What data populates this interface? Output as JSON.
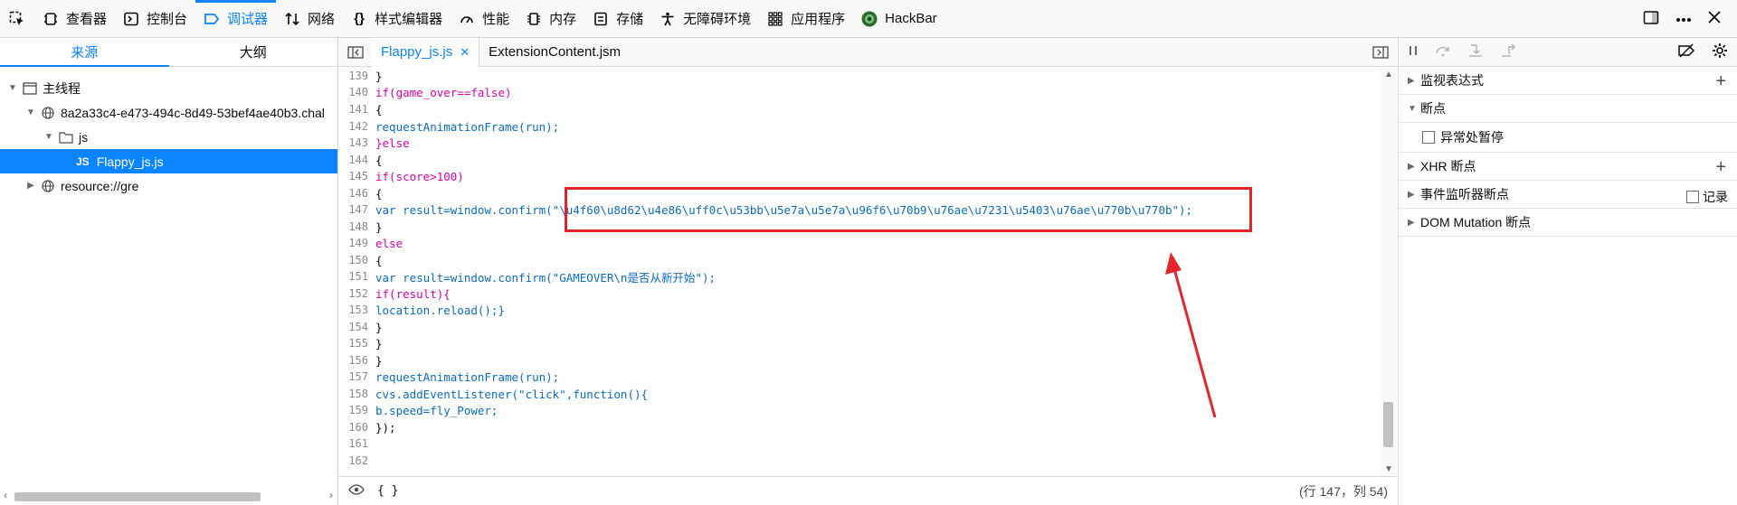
{
  "toolbar": {
    "tabs": [
      {
        "label": "查看器",
        "icon": "inspector-icon"
      },
      {
        "label": "控制台",
        "icon": "console-icon"
      },
      {
        "label": "调试器",
        "icon": "debugger-icon"
      },
      {
        "label": "网络",
        "icon": "network-icon"
      },
      {
        "label": "样式编辑器",
        "icon": "style-editor-icon"
      },
      {
        "label": "性能",
        "icon": "performance-icon"
      },
      {
        "label": "内存",
        "icon": "memory-icon"
      },
      {
        "label": "存储",
        "icon": "storage-icon"
      },
      {
        "label": "无障碍环境",
        "icon": "accessibility-icon"
      },
      {
        "label": "应用程序",
        "icon": "application-icon"
      },
      {
        "label": "HackBar",
        "icon": "hackbar-icon"
      }
    ],
    "active_tab": "调试器",
    "accent": "#0a84ff"
  },
  "sources": {
    "tabs": [
      "来源",
      "大纲"
    ],
    "active_tab": "来源",
    "tree": [
      {
        "label": "主线程",
        "icon": "window-icon",
        "twisty": "open"
      },
      {
        "label": "8a2a33c4-e473-494c-8d49-53bef4ae40b3.chal",
        "icon": "globe-icon",
        "twisty": "open"
      },
      {
        "label": "js",
        "icon": "folder-icon",
        "twisty": "open"
      },
      {
        "label": "Flappy_js.js",
        "icon": "js-file-icon",
        "badge": "JS",
        "selected": true
      },
      {
        "label": "resource://gre",
        "icon": "globe-icon",
        "twisty": "closed"
      }
    ]
  },
  "editor": {
    "tabs": [
      {
        "label": "Flappy_js.js",
        "active": true,
        "close": "✕"
      },
      {
        "label": "ExtensionContent.jsm",
        "active": false
      }
    ],
    "lines": [
      {
        "n": "139",
        "text": "}"
      },
      {
        "n": "140",
        "text": "if(game_over==false)"
      },
      {
        "n": "141",
        "text": "{"
      },
      {
        "n": "142",
        "text": "requestAnimationFrame(run);"
      },
      {
        "n": "143",
        "text": "}else"
      },
      {
        "n": "144",
        "text": "{"
      },
      {
        "n": "145",
        "text": "if(score>100)"
      },
      {
        "n": "146",
        "text": "{"
      },
      {
        "n": "147",
        "text": "var result=window.confirm(\"\\u4f60\\u8d62\\u4e86\\uff0c\\u53bb\\u5e7a\\u5e7a\\u96f6\\u70b9\\u76ae\\u7231\\u5403\\u76ae\\u770b\\u770b\");"
      },
      {
        "n": "148",
        "text": "}"
      },
      {
        "n": "149",
        "text": "else"
      },
      {
        "n": "150",
        "text": "{"
      },
      {
        "n": "151",
        "text": "var result=window.confirm(\"GAMEOVER\\n是否从新开始\");"
      },
      {
        "n": "152",
        "text": "if(result){"
      },
      {
        "n": "153",
        "text": "location.reload();}"
      },
      {
        "n": "154",
        "text": "}"
      },
      {
        "n": "155",
        "text": "}"
      },
      {
        "n": "156",
        "text": "}"
      },
      {
        "n": "157",
        "text": "requestAnimationFrame(run);"
      },
      {
        "n": "158",
        "text": "cvs.addEventListener(\"click\",function(){"
      },
      {
        "n": "159",
        "text": "b.speed=fly_Power;"
      },
      {
        "n": "160",
        "text": "});"
      },
      {
        "n": "161",
        "text": ""
      },
      {
        "n": "162",
        "text": ""
      }
    ],
    "footer_braces": "{ }",
    "cursor_position": "(行 147，列 54)",
    "annotation_color": "#e4262c"
  },
  "right_pane": {
    "sections": [
      {
        "label": "监视表达式",
        "state": "closed",
        "action": "+"
      },
      {
        "label": "断点",
        "state": "open"
      },
      {
        "label": "XHR 断点",
        "state": "closed",
        "action": "+"
      },
      {
        "label": "事件监听器断点",
        "state": "closed",
        "checkbox_label": "记录"
      },
      {
        "label": "DOM Mutation 断点",
        "state": "closed"
      }
    ],
    "breakpoints_option": "异常处暂停"
  }
}
